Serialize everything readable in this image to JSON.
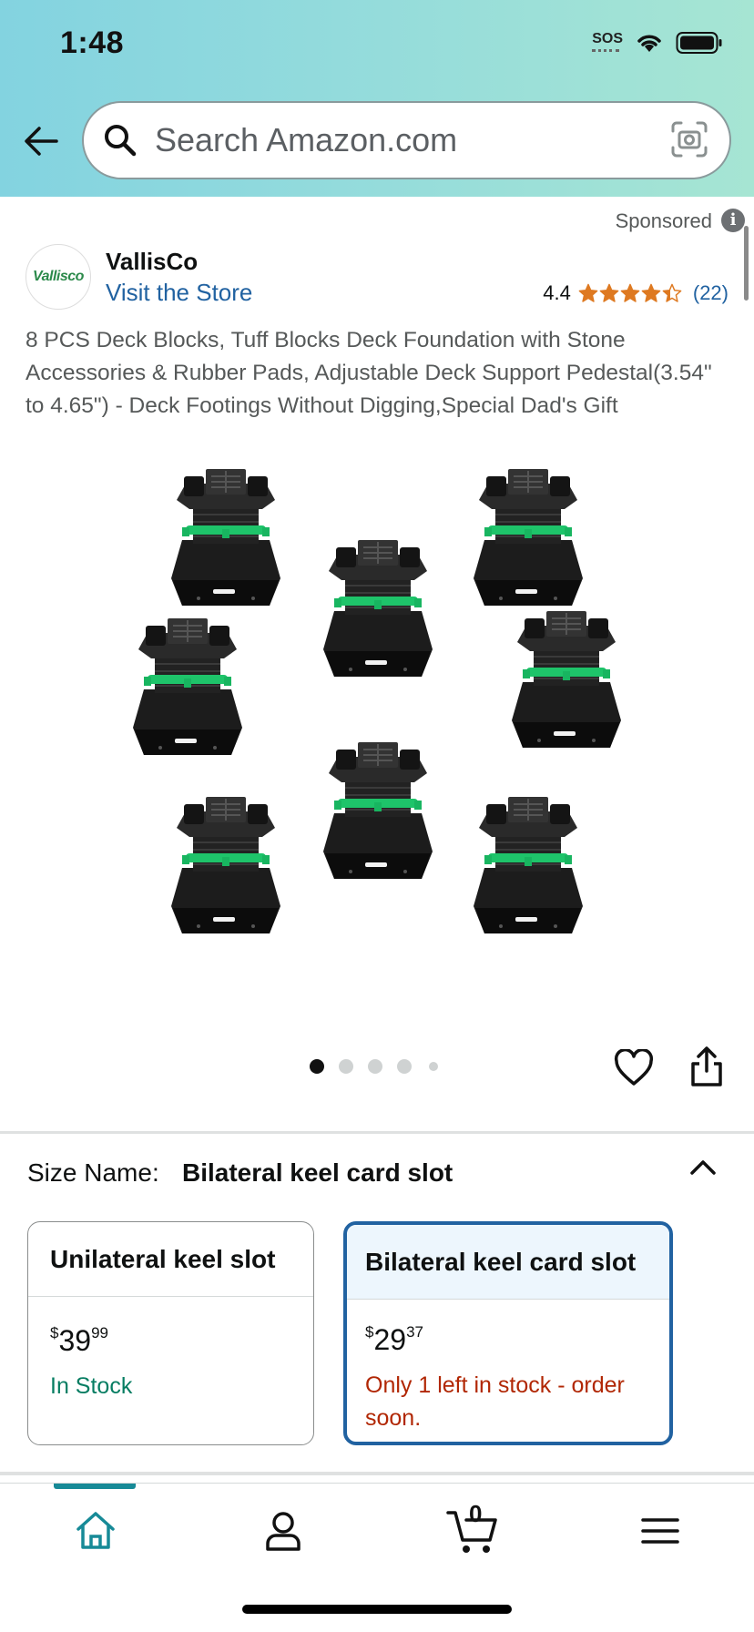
{
  "status_bar": {
    "time": "1:48",
    "sos": "SOS"
  },
  "search": {
    "placeholder": "Search Amazon.com"
  },
  "sponsored": {
    "label": "Sponsored",
    "info": "i"
  },
  "store": {
    "logo_text": "Vallisco",
    "name": "VallisCo",
    "link": "Visit the Store"
  },
  "rating": {
    "value": "4.4",
    "stars": 4.4,
    "count": "(22)",
    "star_color": "#de7921"
  },
  "product": {
    "title": "8 PCS Deck Blocks, Tuff Blocks Deck Foundation with Stone Accessories & Rubber Pads, Adjustable Deck Support Pedestal(3.54\" to 4.65\") - Deck Footings Without Digging,Special Dad's Gift",
    "image_count": 5,
    "active_image": 1
  },
  "size": {
    "label": "Size Name:",
    "selected": "Bilateral keel card slot",
    "options": [
      {
        "name": "Unilateral keel slot",
        "currency": "$",
        "price_whole": "39",
        "price_fraction": "99",
        "stock": "In Stock",
        "selected": false
      },
      {
        "name": "Bilateral keel card slot",
        "currency": "$",
        "price_whole": "29",
        "price_fraction": "37",
        "stock": "Only 1 left in stock - order soon.",
        "selected": true
      }
    ]
  },
  "bottom_nav": {
    "items": [
      "home-icon",
      "account-icon",
      "cart-icon",
      "menu-icon"
    ],
    "cart_count": "0",
    "accent": "#178a97"
  },
  "colors": {
    "link": "#2162a1",
    "in_stock": "#067d62",
    "low_stock": "#b12704",
    "selected_border": "#2162a1"
  }
}
